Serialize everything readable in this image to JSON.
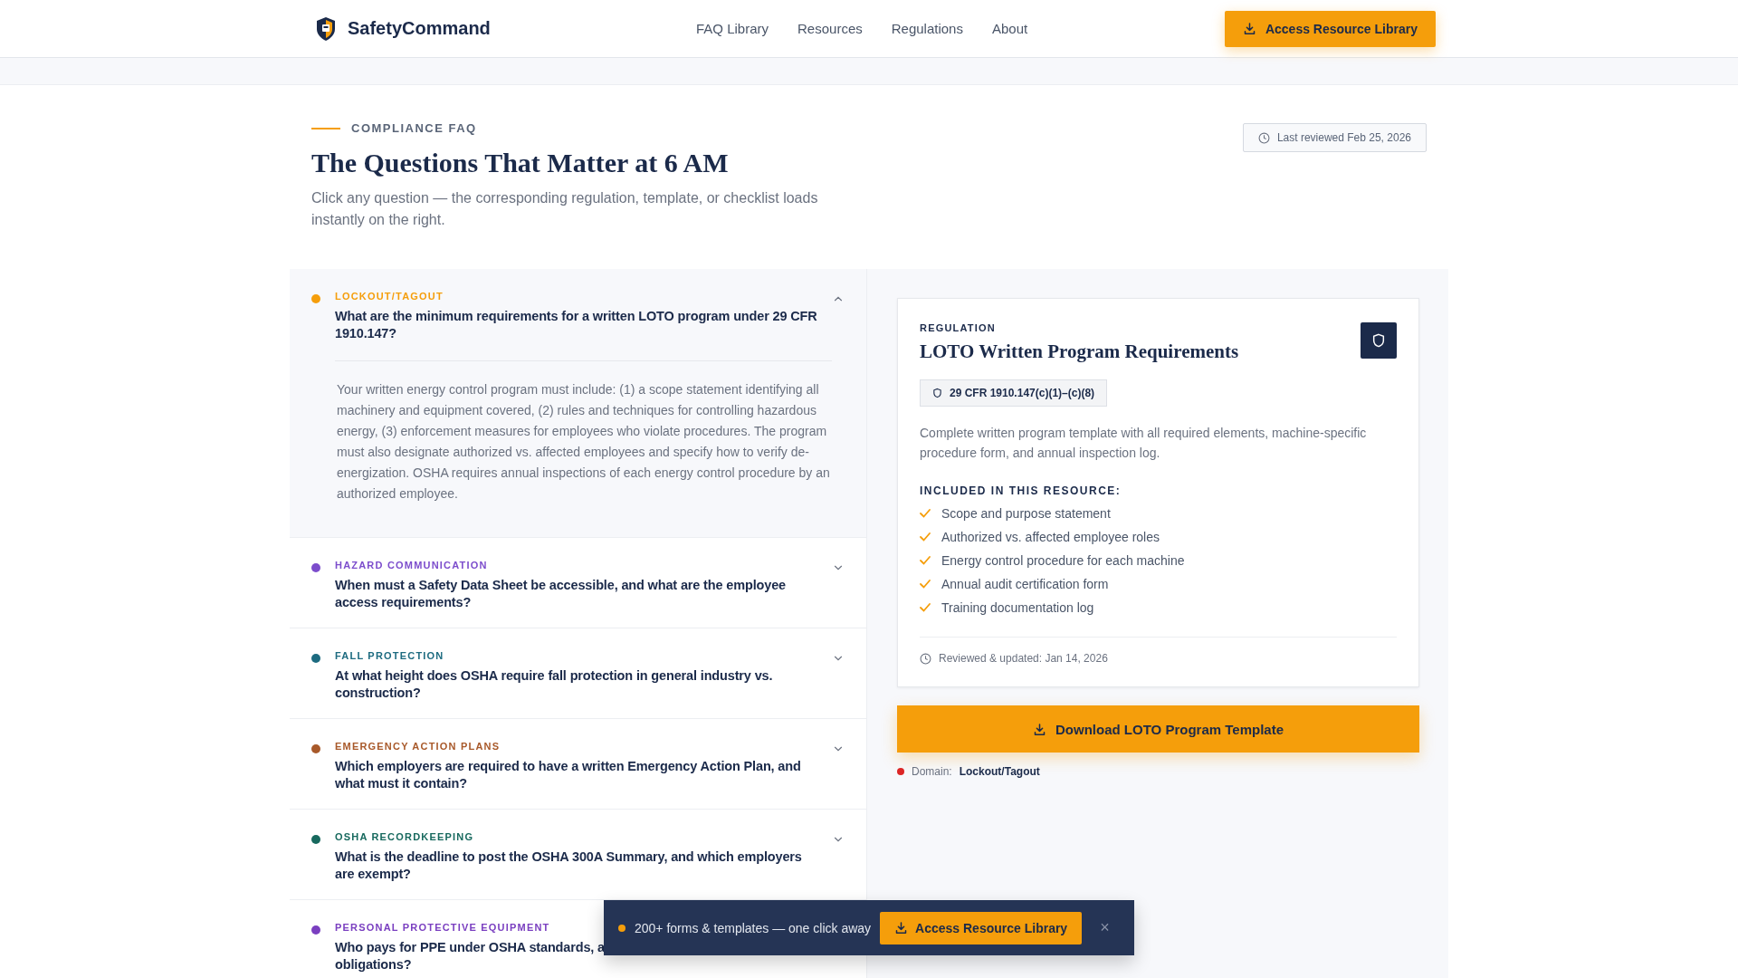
{
  "header": {
    "brand": "SafetyCommand",
    "nav": [
      {
        "label": "FAQ Library"
      },
      {
        "label": "Resources"
      },
      {
        "label": "Regulations"
      },
      {
        "label": "About"
      }
    ],
    "cta": "Access Resource Library"
  },
  "hero": {
    "eyebrow": "COMPLIANCE FAQ",
    "title": "The Questions That Matter at 6 AM",
    "subtitle": "Click any question — the corresponding regulation, template, or checklist loads instantly on the right.",
    "reviewed": "Last reviewed Feb 25, 2026"
  },
  "faq": [
    {
      "category": "LOCKOUT/TAGOUT",
      "color": "#f59e0b",
      "question": "What are the minimum requirements for a written LOTO program under 29 CFR 1910.147?",
      "expanded": true,
      "answer": "Your written energy control program must include: (1) a scope statement identifying all machinery and equipment covered, (2) rules and techniques for controlling hazardous energy, (3) enforcement measures for employees who violate procedures. The program must also designate authorized vs. affected employees and specify how to verify de-energization. OSHA requires annual inspections of each energy control procedure by an authorized employee."
    },
    {
      "category": "HAZARD COMMUNICATION",
      "color": "#7c4dcc",
      "question": "When must a Safety Data Sheet be accessible, and what are the employee access requirements?",
      "expanded": false
    },
    {
      "category": "FALL PROTECTION",
      "color": "#1d6b80",
      "question": "At what height does OSHA require fall protection in general industry vs. construction?",
      "expanded": false
    },
    {
      "category": "EMERGENCY ACTION PLANS",
      "color": "#a8592a",
      "question": "Which employers are required to have a written Emergency Action Plan, and what must it contain?",
      "expanded": false
    },
    {
      "category": "OSHA RECORDKEEPING",
      "color": "#17695e",
      "question": "What is the deadline to post the OSHA 300A Summary, and which employers are exempt?",
      "expanded": false
    },
    {
      "category": "PERSONAL PROTECTIVE EQUIPMENT",
      "color": "#7a3fc0",
      "question": "Who pays for PPE under OSHA standards, a",
      "question_end": "obligations?",
      "expanded": false
    }
  ],
  "resource": {
    "type": "REGULATION",
    "title": "LOTO Written Program Requirements",
    "citation": "29 CFR 1910.147(c)(1)–(c)(8)",
    "description": "Complete written program template with all required elements, machine-specific procedure form, and annual inspection log.",
    "included_heading": "INCLUDED IN THIS RESOURCE:",
    "included": [
      "Scope and purpose statement",
      "Authorized vs. affected employee roles",
      "Energy control procedure for each machine",
      "Annual audit certification form",
      "Training documentation log"
    ],
    "reviewed": "Reviewed & updated: Jan 14, 2026",
    "download": "Download LOTO Program Template",
    "domain_label": "Domain:",
    "domain": "Lockout/Tagout"
  },
  "toast": {
    "text": "200+ forms & templates — one click away",
    "button": "Access Resource Library",
    "close": "×"
  }
}
